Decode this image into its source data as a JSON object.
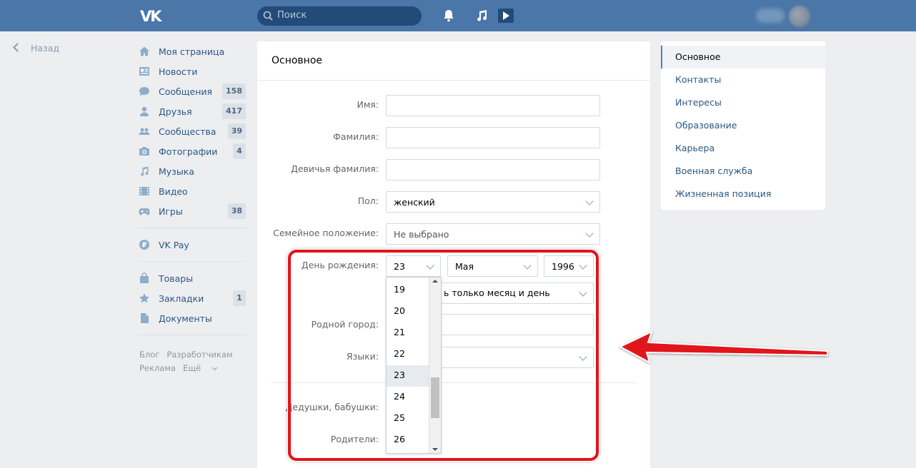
{
  "header": {
    "logo": "VK",
    "search_placeholder": "Поиск"
  },
  "back_label": "Назад",
  "menu": {
    "items": [
      {
        "label": "Моя страница",
        "icon": "home-icon",
        "badge": ""
      },
      {
        "label": "Новости",
        "icon": "news-icon",
        "badge": ""
      },
      {
        "label": "Сообщения",
        "icon": "messages-icon",
        "badge": "158"
      },
      {
        "label": "Друзья",
        "icon": "friends-icon",
        "badge": "417"
      },
      {
        "label": "Сообщества",
        "icon": "communities-icon",
        "badge": "39"
      },
      {
        "label": "Фотографии",
        "icon": "camera-icon",
        "badge": "4"
      },
      {
        "label": "Музыка",
        "icon": "music-icon",
        "badge": ""
      },
      {
        "label": "Видео",
        "icon": "video-icon",
        "badge": ""
      },
      {
        "label": "Игры",
        "icon": "gamepad-icon",
        "badge": "38"
      }
    ],
    "vkpay": "VK Pay",
    "extra": [
      {
        "label": "Товары",
        "icon": "shopping-bag-icon",
        "badge": ""
      },
      {
        "label": "Закладки",
        "icon": "star-icon",
        "badge": "1"
      },
      {
        "label": "Документы",
        "icon": "document-icon",
        "badge": ""
      }
    ],
    "footer": [
      "Блог",
      "Разработчикам",
      "Реклама",
      "Ещё"
    ]
  },
  "main": {
    "title": "Основное",
    "fields": {
      "first_name_label": "Имя:",
      "last_name_label": "Фамилия:",
      "maiden_name_label": "Девичья фамилия:",
      "gender_label": "Пол:",
      "gender_value": "женский",
      "marital_label": "Семейное положение:",
      "marital_value": "Не выбрано",
      "birthday_label": "День рождения:",
      "birth_day": "23",
      "birth_month": "Мая",
      "birth_year": "1996",
      "birthday_visibility_partial": "ь только месяц и день",
      "hometown_label": "Родной город:",
      "languages_label": "Языки:",
      "grandparents_label": "Дедушки, бабушки:",
      "parents_label": "Родители:"
    },
    "day_options": [
      "19",
      "20",
      "21",
      "22",
      "23",
      "24",
      "25",
      "26"
    ],
    "selected_day": "23"
  },
  "right_nav": [
    "Основное",
    "Контакты",
    "Интересы",
    "Образование",
    "Карьера",
    "Военная служба",
    "Жизненная позиция"
  ],
  "colors": {
    "header": "#4a76a8",
    "link": "#2a5885",
    "highlight": "#e0141b"
  }
}
